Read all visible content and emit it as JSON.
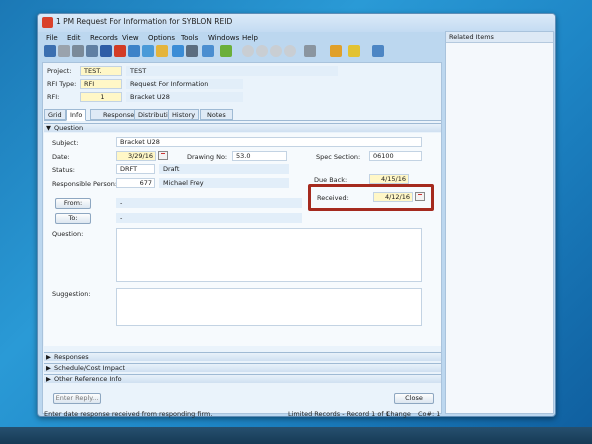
{
  "window": {
    "title": "1 PM Request For Information for SYBLON REID"
  },
  "menu": [
    "File",
    "Edit",
    "Records",
    "View",
    "Options",
    "Tools",
    "Windows",
    "Help"
  ],
  "header": {
    "project_label": "Project:",
    "project_code": "TEST.",
    "project_name": "TEST",
    "rfitype_label": "RFI Type:",
    "rfitype_code": "RFI",
    "rfitype_name": "Request For Information",
    "rfi_label": "RFI:",
    "rfi_number": "1",
    "rfi_name": "Bracket U28"
  },
  "tabs": [
    "Grid",
    "Info",
    "Response",
    "Distribution",
    "History",
    "Notes"
  ],
  "question_section": "Question",
  "form": {
    "subject_label": "Subject:",
    "subject": "Bracket U28",
    "date_label": "Date:",
    "date": "3/29/16",
    "drawing_label": "Drawing No:",
    "drawing": "53.0",
    "spec_label": "Spec Section:",
    "spec": "06100",
    "status_label": "Status:",
    "status_code": "DRFT",
    "status_name": "Draft",
    "responsible_label": "Responsible Person:",
    "responsible_id": "677",
    "responsible_name": "Michael Frey",
    "dueback_label": "Due Back:",
    "dueback": "4/15/16",
    "received_label": "Received:",
    "received": "4/12/16",
    "from_button": "From:",
    "from_value": "-",
    "to_button": "To:",
    "to_value": "-",
    "question_label": "Question:",
    "suggestion_label": "Suggestion:"
  },
  "sections": [
    "Responses",
    "Schedule/Cost Impact",
    "Other Reference Info"
  ],
  "buttons": {
    "enter_reply": "Enter Reply...",
    "close": "Close"
  },
  "status_bar": {
    "hint": "Enter date response received from responding firm.",
    "limited": "Limited Records - Record 1 of 1",
    "change": "Change",
    "co": "Co#: 1"
  },
  "right_pane": {
    "title": "Related Items"
  },
  "highlight_color": "#a52a1e"
}
